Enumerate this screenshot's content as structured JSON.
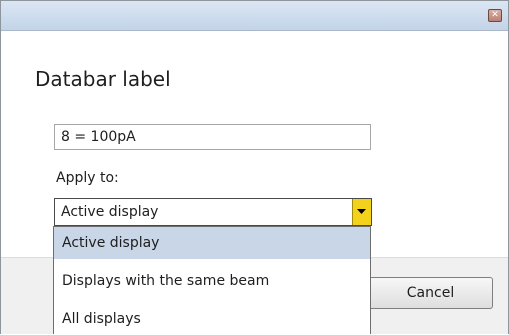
{
  "dialog": {
    "title": "Databar label",
    "close_icon": "close-icon",
    "close_glyph": "✕"
  },
  "label_input": {
    "value": "8 = 100pA"
  },
  "apply_to": {
    "label": "Apply to:",
    "selected": "Active display",
    "options": [
      "Active display",
      "Displays with the same beam",
      "All displays"
    ],
    "highlighted_index": 0
  },
  "footer": {
    "cancel_label": "Cancel"
  },
  "colors": {
    "titlebar": "#c3d4e8",
    "dropdown_arrow": "#f3d21c",
    "highlight": "#c9d6e7"
  }
}
